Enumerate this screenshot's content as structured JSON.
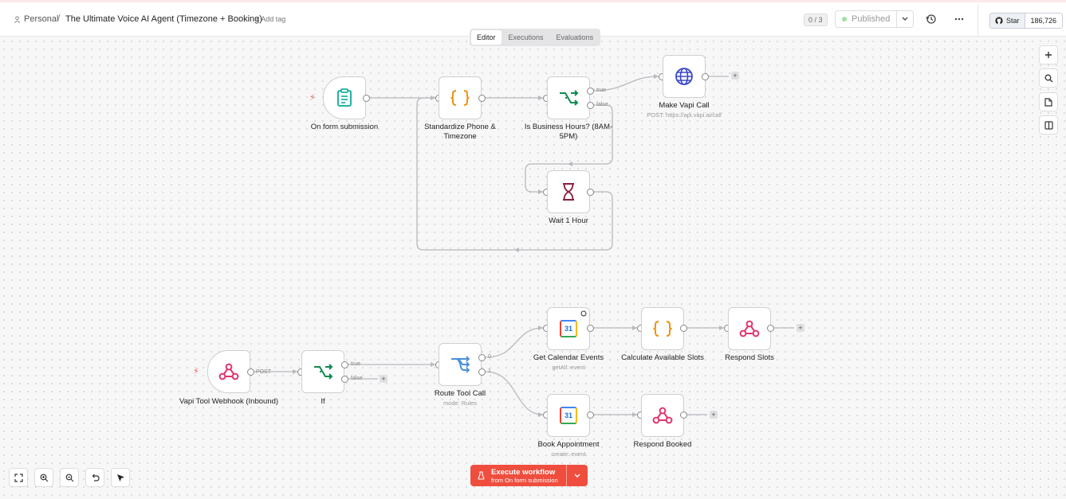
{
  "header": {
    "workspace": "Personal",
    "separator": "/",
    "workflow_title": "The Ultimate Voice AI Agent (Timezone + Booking)",
    "add_tag": "+ Add tag",
    "counter": "0 / 3",
    "status": "Published",
    "github_star": "Star",
    "github_count": "186,726"
  },
  "tabs": [
    {
      "label": "Editor",
      "active": true
    },
    {
      "label": "Executions",
      "active": false
    },
    {
      "label": "Evaluations",
      "active": false
    }
  ],
  "nodes": {
    "form": {
      "label": "On form submission",
      "icon": "clipboard-icon"
    },
    "standardize": {
      "label": "Standardize Phone & Timezone",
      "icon": "code-braces-icon"
    },
    "business_hours": {
      "label": "Is Business Hours? (8AM-5PM)",
      "icon": "if-branch-icon",
      "port_true": "true",
      "port_false": "false"
    },
    "vapi_call": {
      "label": "Make Vapi Call",
      "sub": "POST: https://api.vapi.ai/call",
      "icon": "globe-icon"
    },
    "wait": {
      "label": "Wait 1 Hour",
      "icon": "hourglass-icon"
    },
    "webhook": {
      "label": "Vapi Tool Webhook (Inbound)",
      "method": "POST",
      "icon": "webhook-icon"
    },
    "if": {
      "label": "If",
      "port_true": "true",
      "port_false": "false",
      "icon": "if-branch-icon"
    },
    "route": {
      "label": "Route Tool Call",
      "sub": "mode: Rules",
      "port0": "0",
      "port1": "1",
      "icon": "switch-icon"
    },
    "get_calendar": {
      "label": "Get Calendar Events",
      "sub": "getAll: event",
      "icon": "google-calendar-icon",
      "day": "31"
    },
    "calc_slots": {
      "label": "Calculate Available Slots",
      "icon": "code-braces-icon"
    },
    "respond_slots": {
      "label": "Respond Slots",
      "icon": "webhook-icon"
    },
    "book": {
      "label": "Book Appointment",
      "sub": "create: event",
      "icon": "google-calendar-icon",
      "day": "31"
    },
    "respond_booked": {
      "label": "Respond Booked",
      "icon": "webhook-icon"
    }
  },
  "plus": "+",
  "execute": {
    "title": "Execute workflow",
    "subtitle": "from On form submission"
  },
  "colors": {
    "accent": "#ef4e3f",
    "code": "#f29111",
    "if": "#0f8a4f",
    "webhook": "#e0356e",
    "globe": "#3b49c9",
    "wait": "#8b1e3f",
    "switch": "#4a90d9"
  }
}
